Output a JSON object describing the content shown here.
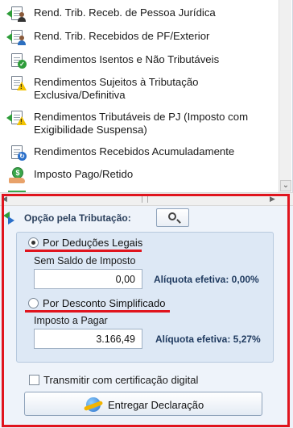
{
  "sidebar": {
    "items": [
      {
        "label_lines": [
          "Rend. Trib. Receb. de Pessoa Jurídica"
        ],
        "icon": "document-person-icon"
      },
      {
        "label_lines": [
          "Rend. Trib. Recebidos de PF/Exterior"
        ],
        "icon": "document-person-blue-icon"
      },
      {
        "label_lines": [
          "Rendimentos Isentos e Não Tributáveis"
        ],
        "icon": "document-check-icon"
      },
      {
        "label_lines": [
          "Rendimentos Sujeitos à Tributação",
          "Exclusiva/Definitiva"
        ],
        "icon": "document-warning-icon"
      },
      {
        "label_lines": [
          "Rendimentos Tributáveis de PJ (Imposto com",
          "Exigibilidade Suspensa)"
        ],
        "icon": "document-person-warning-icon"
      },
      {
        "label_lines": [
          "Rendimentos Recebidos Acumuladamente"
        ],
        "icon": "document-refresh-icon"
      },
      {
        "label_lines": [
          "Imposto Pago/Retido"
        ],
        "icon": "coin-hand-icon"
      }
    ]
  },
  "taxation": {
    "header_label": "Opção pela Tributação:",
    "search_icon": "search-icon",
    "options": [
      {
        "label": "Por Deduções Legais",
        "selected": true,
        "sub_label": "Sem Saldo de Imposto",
        "value": "0,00",
        "rate": "Alíquota efetiva: 0,00%"
      },
      {
        "label": "Por Desconto Simplificado",
        "selected": false,
        "sub_label": "Imposto a Pagar",
        "value": "3.166,49",
        "rate": "Alíquota efetiva: 5,27%"
      }
    ],
    "transmit_label": "Transmitir com certificação digital",
    "transmit_checked": false,
    "submit_label": "Entregar Declaração",
    "submit_icon": "globe-icon"
  },
  "colors": {
    "highlight": "#e0141d",
    "panel_bg": "#eef3fa",
    "box_bg": "#dde8f5",
    "accent_green": "#2e9d3a"
  }
}
